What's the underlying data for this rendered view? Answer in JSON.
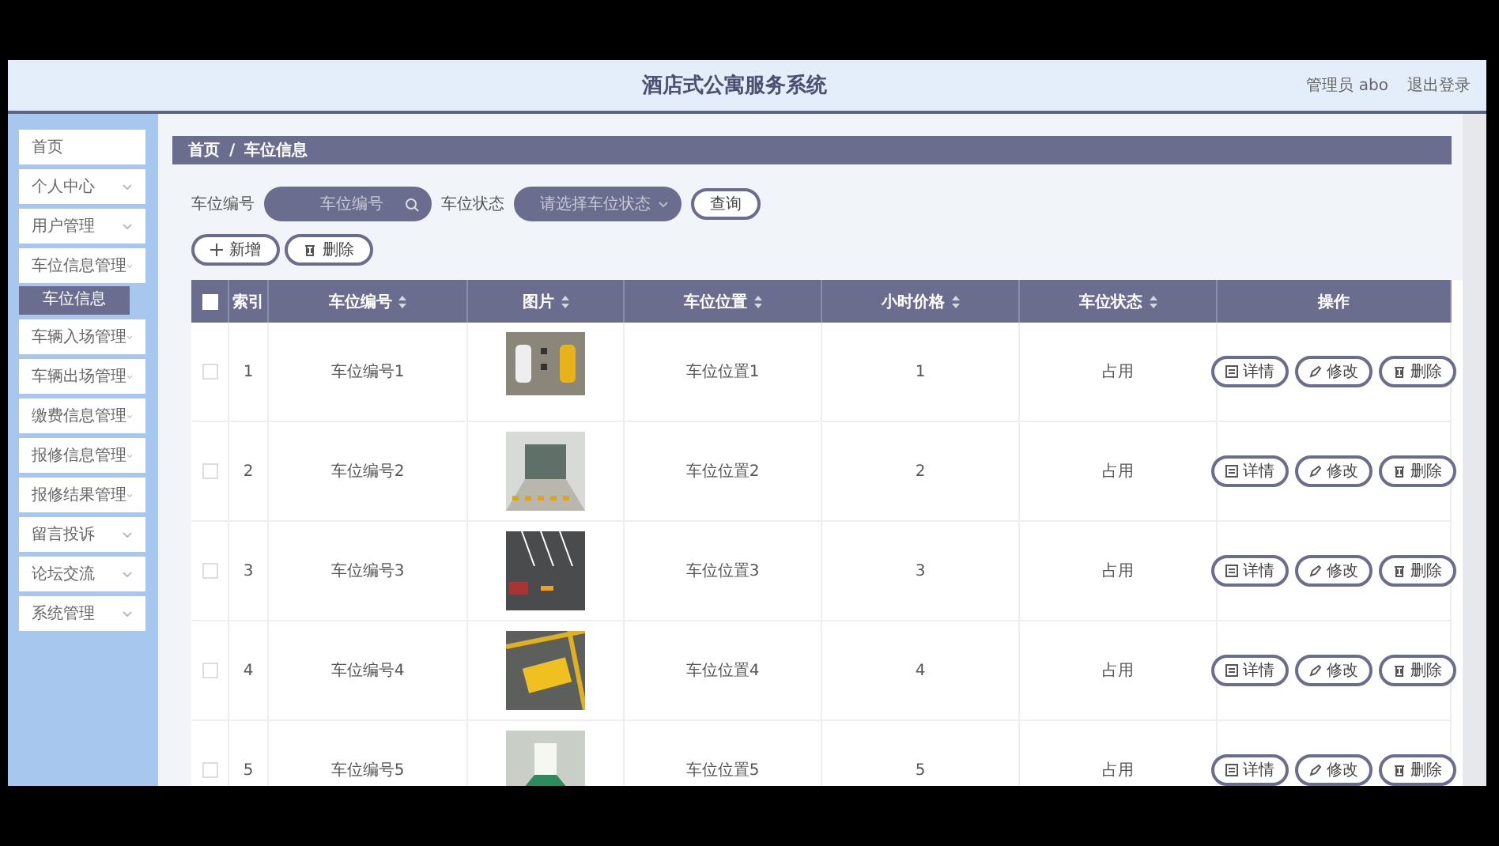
{
  "header": {
    "title": "酒店式公寓服务系统",
    "user": "管理员 abo",
    "logout": "退出登录"
  },
  "sidebar": {
    "items": [
      {
        "label": "首页",
        "expandable": false
      },
      {
        "label": "个人中心",
        "expandable": true
      },
      {
        "label": "用户管理",
        "expandable": true
      },
      {
        "label": "车位信息管理",
        "expandable": true,
        "children": [
          {
            "label": "车位信息",
            "selected": true
          }
        ]
      },
      {
        "label": "车辆入场管理",
        "expandable": true
      },
      {
        "label": "车辆出场管理",
        "expandable": true
      },
      {
        "label": "缴费信息管理",
        "expandable": true
      },
      {
        "label": "报修信息管理",
        "expandable": true
      },
      {
        "label": "报修结果管理",
        "expandable": true
      },
      {
        "label": "留言投诉",
        "expandable": true
      },
      {
        "label": "论坛交流",
        "expandable": true
      },
      {
        "label": "系统管理",
        "expandable": true
      }
    ]
  },
  "breadcrumb": [
    "首页",
    "/",
    "车位信息"
  ],
  "search": {
    "number_label": "车位编号",
    "number_placeholder": "车位编号",
    "status_label": "车位状态",
    "status_placeholder": "请选择车位状态",
    "query_button": "查询"
  },
  "toolbar": {
    "add": "新增",
    "delete": "删除"
  },
  "table": {
    "select_all_checked": false,
    "columns": [
      {
        "label": "索引",
        "sortable": false
      },
      {
        "label": "车位编号",
        "sortable": true
      },
      {
        "label": "图片",
        "sortable": true
      },
      {
        "label": "车位位置",
        "sortable": true
      },
      {
        "label": "小时价格",
        "sortable": true
      },
      {
        "label": "车位状态",
        "sortable": true
      },
      {
        "label": "操作",
        "sortable": false
      }
    ],
    "rows": [
      {
        "checked": false,
        "index": "1",
        "number": "车位编号1",
        "kind": "top-view",
        "location": "车位位置1",
        "price": "1",
        "status": "占用",
        "actions": [
          "详情",
          "修改",
          "删除"
        ]
      },
      {
        "checked": false,
        "index": "2",
        "number": "车位编号2",
        "kind": "garage",
        "location": "车位位置2",
        "price": "2",
        "status": "占用",
        "actions": [
          "详情",
          "修改",
          "删除"
        ]
      },
      {
        "checked": false,
        "index": "3",
        "number": "车位编号3",
        "kind": "lot",
        "location": "车位位置3",
        "price": "3",
        "status": "占用",
        "actions": [
          "详情",
          "修改",
          "删除"
        ]
      },
      {
        "checked": false,
        "index": "4",
        "number": "车位编号4",
        "kind": "marking",
        "location": "车位位置4",
        "price": "4",
        "status": "占用",
        "actions": [
          "详情",
          "修改",
          "删除"
        ]
      },
      {
        "checked": false,
        "index": "5",
        "number": "车位编号5",
        "kind": "tunnel",
        "location": "车位位置5",
        "price": "5",
        "status": "占用",
        "actions": [
          "详情",
          "修改",
          "删除"
        ]
      }
    ]
  }
}
